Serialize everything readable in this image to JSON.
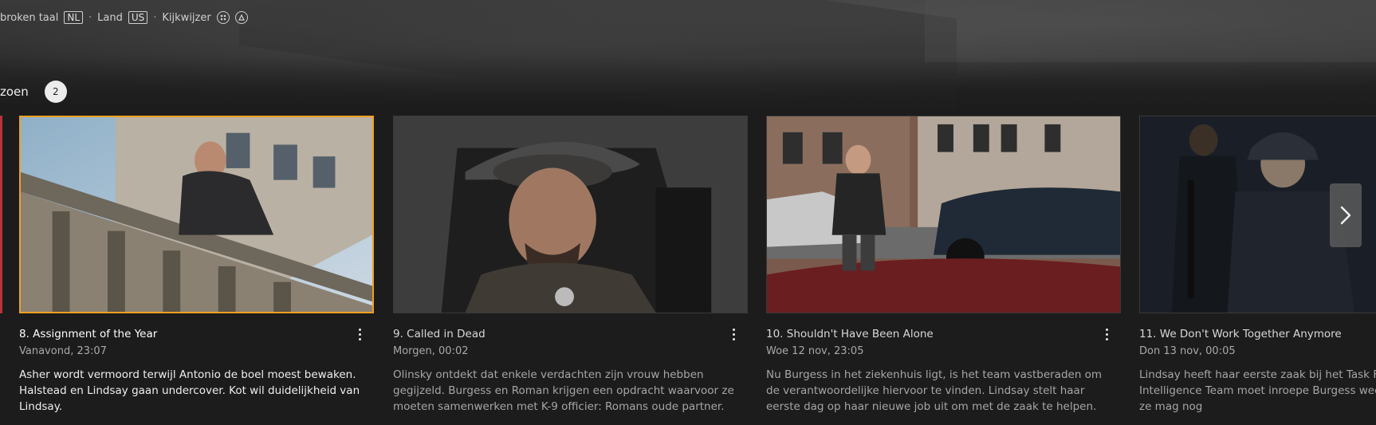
{
  "meta": {
    "spoken_language_label": "broken taal",
    "spoken_language_value": "NL",
    "country_label": "Land",
    "country_value": "US",
    "viewing_guide_label": "Kijkwijzer",
    "separator": "·",
    "rating_icons": [
      "violence-rating-icon",
      "fear-rating-icon"
    ]
  },
  "season": {
    "label": "zoen",
    "number": "2"
  },
  "colors": {
    "focus_border": "#f0a020",
    "background": "#1c1c1c",
    "edge_accent": "#b8333a"
  },
  "episodes": [
    {
      "title": "8. Assignment of the Year",
      "airtime": "Vanavond, 23:07",
      "description": "Asher wordt vermoord terwijl Antonio de boel moest bewaken. Halstead en Lindsay gaan undercover. Kot wil duidelijkheid van Lindsay.",
      "focused": true
    },
    {
      "title": "9. Called in Dead",
      "airtime": "Morgen, 00:02",
      "description": "Olinsky ontdekt dat enkele verdachten zijn vrouw hebben gegijzeld. Burgess en Roman krijgen een opdracht waarvoor ze moeten samenwerken met K-9 officier: Romans oude partner.",
      "focused": false
    },
    {
      "title": "10. Shouldn't Have Been Alone",
      "airtime": "Woe 12 nov, 23:05",
      "description": "Nu Burgess in het ziekenhuis ligt, is het team vastberaden om de verantwoordelijke hiervoor te vinden. Lindsay stelt haar eerste dag op haar nieuwe job uit om met de zaak te helpen.",
      "focused": false
    },
    {
      "title": "11. We Don't Work Together Anymore",
      "airtime": "Don 13 nov, 00:05",
      "description": "Lindsay heeft haar eerste zaak bij het Task F hulp van het Intelligence Team moet inroepe Burgess weer aan de slag, maar ze mag nog",
      "focused": false
    }
  ]
}
